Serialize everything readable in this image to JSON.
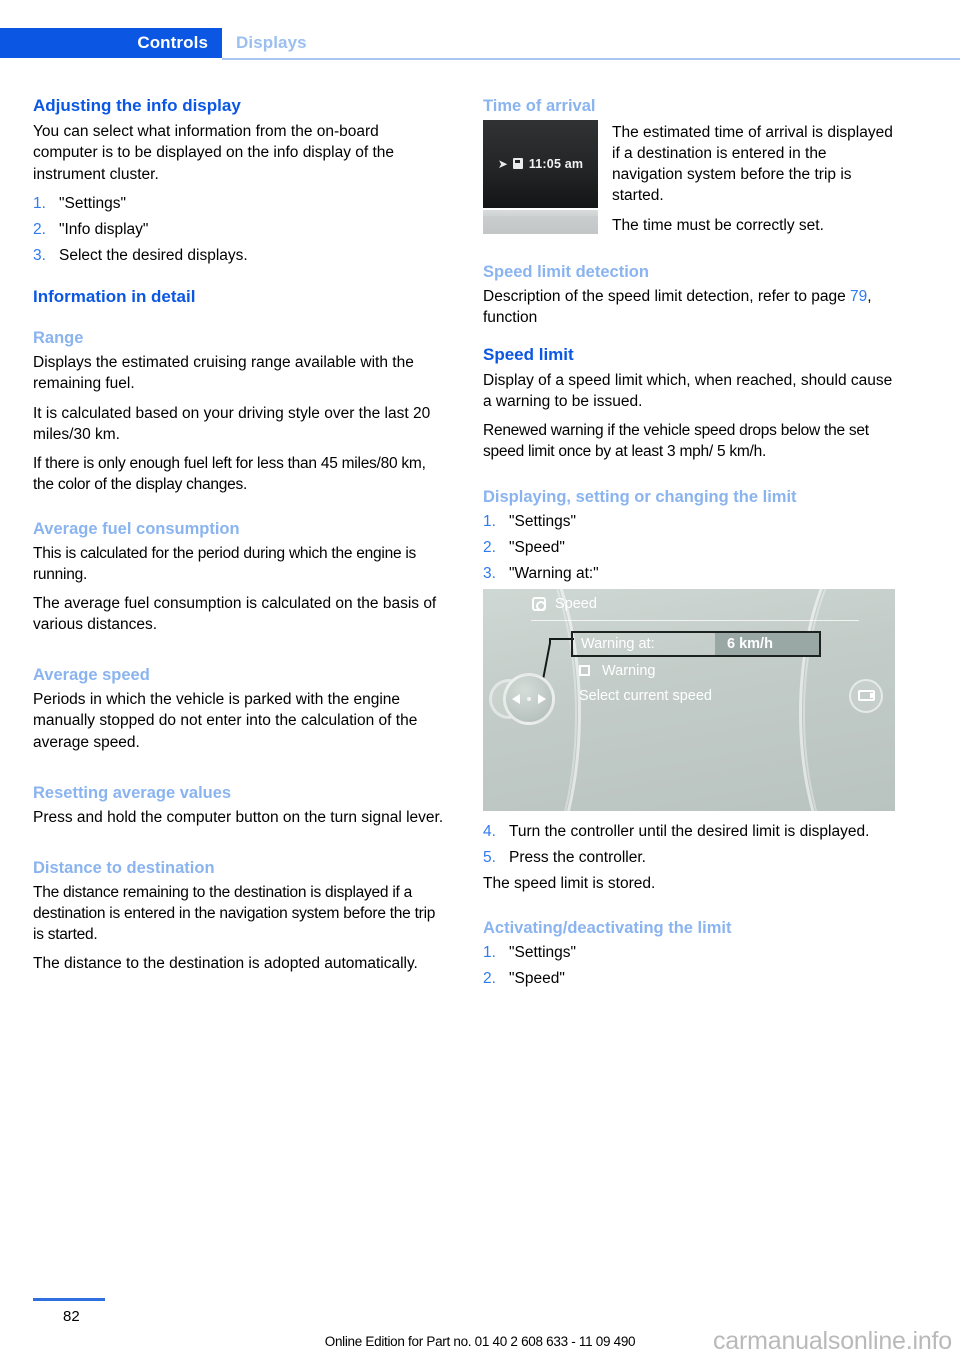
{
  "header": {
    "tab_active": "Controls",
    "tab_inactive": "Displays",
    "accent_color": "#0b57e3",
    "inactive_color": "#9bbff0"
  },
  "left_column": {
    "adjusting": {
      "heading": "Adjusting the info display",
      "intro": "You can select what information from the on-board computer is to be displayed on the info display of the instrument cluster.",
      "steps": [
        {
          "num": "1.",
          "text": "\"Settings\""
        },
        {
          "num": "2.",
          "text": "\"Info display\""
        },
        {
          "num": "3.",
          "text": "Select the desired displays."
        }
      ]
    },
    "information_in_detail": {
      "heading": "Information in detail"
    },
    "range": {
      "heading": "Range",
      "p1": "Displays the estimated cruising range available with the remaining fuel.",
      "p2": "It is calculated based on your driving style over the last 20 miles/30 km.",
      "p3": "If there is only enough fuel left for less than 45 miles/80 km, the color of the display changes."
    },
    "average_fuel_consumption": {
      "heading": "Average fuel consumption",
      "p1": "This is calculated for the period during which the engine is running.",
      "p2": "The average fuel consumption is calculated on the basis of various distances."
    },
    "average_speed": {
      "heading": "Average speed",
      "p1": "Periods in which the vehicle is parked with the engine manually stopped do not enter into the calculation of the average speed."
    },
    "resetting_average_values": {
      "heading": "Resetting average values",
      "p1": "Press and hold the computer button on the turn signal lever."
    },
    "distance_to_destination": {
      "heading": "Distance to destination",
      "p1": "The distance remaining to the destination is displayed if a destination is entered in the navigation system before the trip is started.",
      "p2": "The distance to the destination is adopted automatically."
    }
  },
  "right_column": {
    "time_of_arrival": {
      "heading": "Time of arrival",
      "figure": {
        "time_value": "11:05 am",
        "arrow_icon": "arrow-right-icon",
        "destination_icon": "destination-flag-icon"
      },
      "p1": "The estimated time of arrival is displayed if a destination is entered in the navigation system before the trip is started.",
      "p2": "The time must be correctly set."
    },
    "speed_limit_detection": {
      "heading": "Speed limit detection",
      "text_before": "Description of the speed limit detection, refer to page ",
      "page_link": "79",
      "text_after": ", function"
    },
    "speed_limit": {
      "heading": "Speed limit",
      "p1": "Display of a speed limit which, when reached, should cause a warning to be issued.",
      "p2": "Renewed warning if the vehicle speed drops below the set speed limit once by at least 3 mph/ 5 km/h."
    },
    "displaying_setting_changing": {
      "heading": "Displaying, setting or changing the limit",
      "steps": [
        {
          "num": "1.",
          "text": "\"Settings\""
        },
        {
          "num": "2.",
          "text": "\"Speed\""
        },
        {
          "num": "3.",
          "text": "\"Warning at:\""
        }
      ]
    },
    "idrive_figure": {
      "menu_icon": "settings-gear-icon",
      "title": "Speed",
      "row_label": "Warning at:",
      "row_value": "6 km/h",
      "checkbox_label": "Warning",
      "hint": "Select current speed",
      "left_control_icon": "controller-knob-icon",
      "right_control_icon": "display-button-icon"
    },
    "steps_continued": [
      {
        "num": "4.",
        "text": "Turn the controller until the desired limit is displayed."
      },
      {
        "num": "5.",
        "text": "Press the controller."
      }
    ],
    "stored_note": "The speed limit is stored.",
    "activating_deactivating": {
      "heading": "Activating/deactivating the limit",
      "steps": [
        {
          "num": "1.",
          "text": "\"Settings\""
        },
        {
          "num": "2.",
          "text": "\"Speed\""
        }
      ]
    }
  },
  "footer": {
    "page_number": "82",
    "edition": "Online Edition for Part no. 01 40 2 608 633 - 11 09 490",
    "watermark": "carmanualsonline.info"
  }
}
